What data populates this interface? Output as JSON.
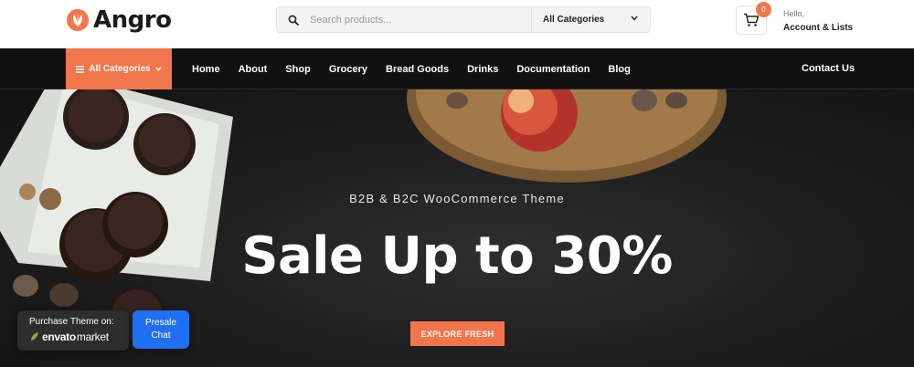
{
  "brand": {
    "name": "Angro",
    "logo_icon": "leaf-logo-icon",
    "accent_color": "#f2764c"
  },
  "search": {
    "placeholder": "Search products...",
    "value": "",
    "category_selected": "All Categories"
  },
  "cart": {
    "count": "0"
  },
  "account": {
    "greeting": "Hello,",
    "label": "Account & Lists"
  },
  "nav": {
    "all_categories": "All Categories",
    "items": [
      {
        "label": "Home"
      },
      {
        "label": "About"
      },
      {
        "label": "Shop"
      },
      {
        "label": "Grocery"
      },
      {
        "label": "Bread Goods"
      },
      {
        "label": "Drinks"
      },
      {
        "label": "Documentation"
      },
      {
        "label": "Blog"
      }
    ],
    "contact": "Contact Us"
  },
  "hero": {
    "subtitle": "B2B & B2C WooCommerce Theme",
    "title": "Sale Up to 30%",
    "cta": "EXPLORE FRESH"
  },
  "purchase_widget": {
    "label": "Purchase Theme on:",
    "brand_bold": "envato",
    "brand_light": "market",
    "presale_line1": "Presale",
    "presale_line2": "Chat"
  }
}
